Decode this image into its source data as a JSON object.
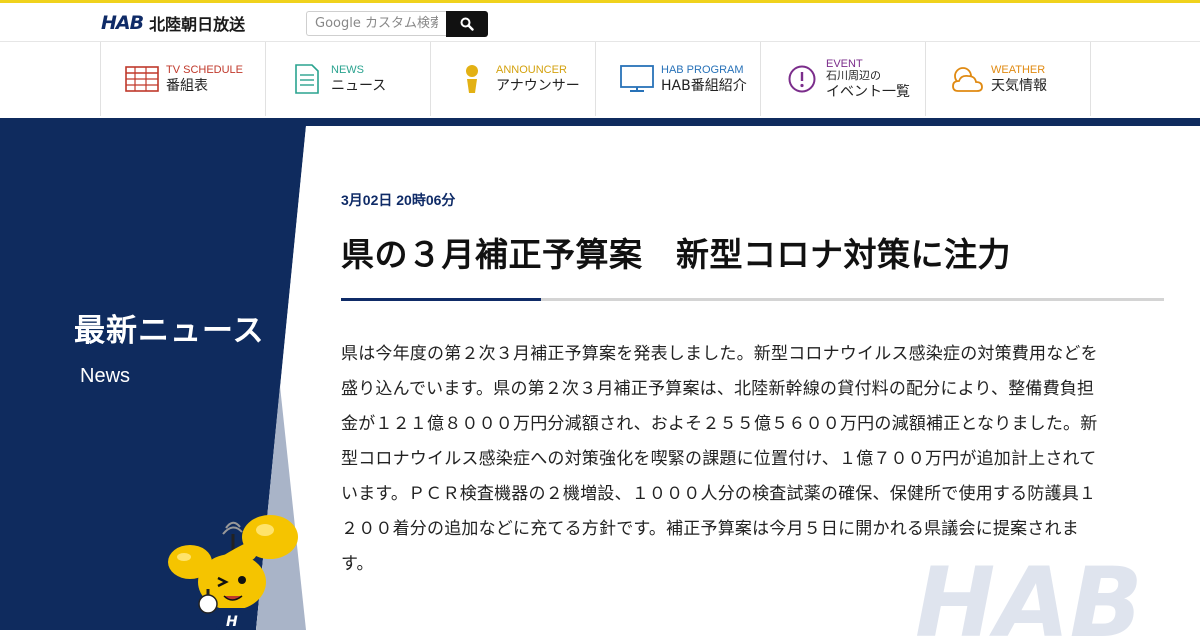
{
  "header": {
    "logo_mark": "HAB",
    "logo_text": "北陸朝日放送",
    "search_placeholder": "Google カスタム検索"
  },
  "nav": [
    {
      "en": "TV SCHEDULE",
      "jp": "番組表",
      "en_color": "#c0392b",
      "icon": "tv-schedule-icon"
    },
    {
      "en": "NEWS",
      "jp": "ニュース",
      "en_color": "#2aa38f",
      "icon": "news-icon"
    },
    {
      "en": "ANNOUNCER",
      "jp": "アナウンサー",
      "en_color": "#d4a20f",
      "icon": "announcer-icon"
    },
    {
      "en": "HAB PROGRAM",
      "jp": "HAB番組紹介",
      "en_color": "#2872b8",
      "icon": "program-icon"
    },
    {
      "en": "EVENT",
      "jp1": "石川周辺の",
      "jp2": "イベント一覧",
      "en_color": "#7b2d8b",
      "icon": "event-icon"
    },
    {
      "en": "WEATHER",
      "jp": "天気情報",
      "en_color": "#e08a12",
      "icon": "weather-icon"
    }
  ],
  "side": {
    "title": "最新ニュース",
    "subtitle": "News"
  },
  "article": {
    "date": "3月02日 20時06分",
    "title": "県の３月補正予算案　新型コロナ対策に注力",
    "body": "県は今年度の第２次３月補正予算案を発表しました。新型コロナウイルス感染症の対策費用などを盛り込んでいます。県の第２次３月補正予算案は、北陸新幹線の貸付料の配分により、整備費負担金が１２１億８０００万円分減額され、およそ２５５億５６００万円の減額補正となりました。新型コロナウイルス感染症への対策強化を喫緊の課題に位置付け、１億７００万円が追加計上されています。ＰＣＲ検査機器の２機増設、１０００人分の検査試薬の確保、保健所で使用する防護具１２００着分の追加などに充てる方針です。補正予算案は今月５日に開かれる県議会に提案されます。"
  },
  "watermark": "HAB",
  "colors": {
    "navy": "#0f2b5e",
    "accent_yellow": "#f0d21c",
    "mascot_yellow": "#f5c400"
  }
}
